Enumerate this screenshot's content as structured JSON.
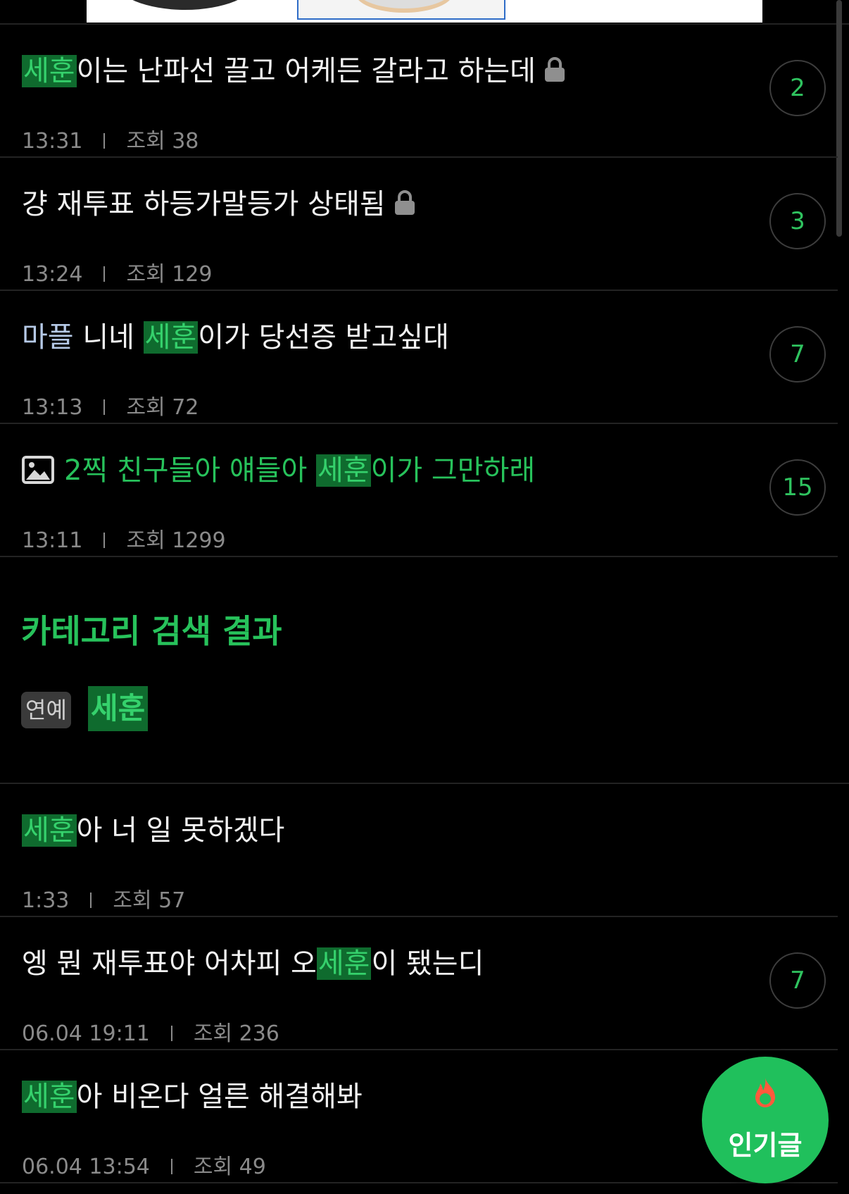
{
  "colors": {
    "background": "#000000",
    "highlight_bg": "#0f6b2e",
    "highlight_text": "#35d16c",
    "accent_green": "#27c25b",
    "meta_gray": "#8a8a8a",
    "visited_title": "#b5c9e6"
  },
  "posts": [
    {
      "title_parts": [
        "세훈",
        "이는 난파선 끌고 어케든 갈라고 하는데"
      ],
      "locked": true,
      "time": "13:31",
      "views": "조회 38",
      "comments": "2"
    },
    {
      "title_parts": [
        "걍 재투표 하등가말등가 상태됨"
      ],
      "locked": true,
      "time": "13:24",
      "views": "조회 129",
      "comments": "3"
    },
    {
      "title_parts": [
        "마플",
        " 니네 ",
        "세훈",
        "이가 당선증 받고싶대"
      ],
      "locked": false,
      "time": "13:13",
      "views": "조회 72",
      "comments": "7"
    },
    {
      "title_parts": [
        "2찍 친구들아 얘들아 ",
        "세훈",
        "이가 그만하래"
      ],
      "has_image_icon": true,
      "time": "13:11",
      "views": "조회 1299",
      "comments": "15"
    }
  ],
  "category_section": {
    "title": "카테고리 검색 결과",
    "tag": "연예",
    "name": "세훈"
  },
  "category_posts": [
    {
      "title_parts": [
        "세훈",
        "아 너 일 못하겠다"
      ],
      "time": "1:33",
      "views": "조회 57"
    },
    {
      "title_parts": [
        "엥 뭔 재투표야 어차피 오",
        "세훈",
        "이 됐는디"
      ],
      "time": "06.04 19:11",
      "views": "조회 236",
      "comments": "7"
    },
    {
      "title_parts": [
        "세훈",
        "아 비온다 얼른 해결해봐"
      ],
      "time": "06.04 13:54",
      "views": "조회 49"
    }
  ],
  "fab": {
    "label": "인기글",
    "icon": "fire-icon"
  }
}
